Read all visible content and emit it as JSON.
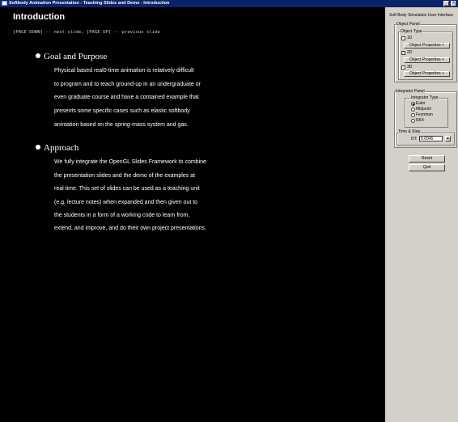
{
  "window": {
    "title": "Softbody Animation Presentation - Teaching Slides and Demo - Introduction",
    "minimize_glyph": "_",
    "close_glyph": "×"
  },
  "slide": {
    "title": "Introduction",
    "nav_hint": "[PAGE DOWN] -- next slide, [PAGE UP] -- previous slide",
    "sections": [
      {
        "heading": "Goal and Purpose",
        "lines": [
          "Physical based real0-time animation is relatively difficult",
          "to program and to teach ground-up in an undergraduate or",
          "even graduate course and have a contained example that",
          "presents some specific cases such as elastic softbody",
          "animation based on the spring-mass system and gas."
        ]
      },
      {
        "heading": "Approach",
        "lines": [
          "We fully integrate the OpenGL Slides Framework to combine",
          "the presentation slides and the demo of the examples at",
          "real time. This set of slides can be used as a teaching unit",
          "(e.g. lecture notes) when expanded and then given out to",
          "the students in a form of a working code to learn from,",
          "extend, and improve, and do their own project presentations."
        ]
      }
    ]
  },
  "panel": {
    "title": "Soft Body Simulation User Interface",
    "object_panel": {
      "legend": "Object Panel",
      "object_type_label": "Object Type",
      "items": [
        {
          "label": "1D",
          "button": "Object Properties +"
        },
        {
          "label": "2D",
          "button": "Object Properties +"
        },
        {
          "label": "3D",
          "button": "Object Properties +"
        }
      ]
    },
    "integrator_panel": {
      "legend": "Integrator Panel",
      "type_label": "Integrator Type",
      "options": [
        "Euler",
        "Midpoint",
        "Feynman",
        "RK4"
      ],
      "selected": "Euler"
    },
    "time_step": {
      "legend": "Time & Step",
      "dt_label": "DT:",
      "dt_value": "0.0045"
    },
    "reset_label": "Reset",
    "quit_label": "Quit"
  }
}
